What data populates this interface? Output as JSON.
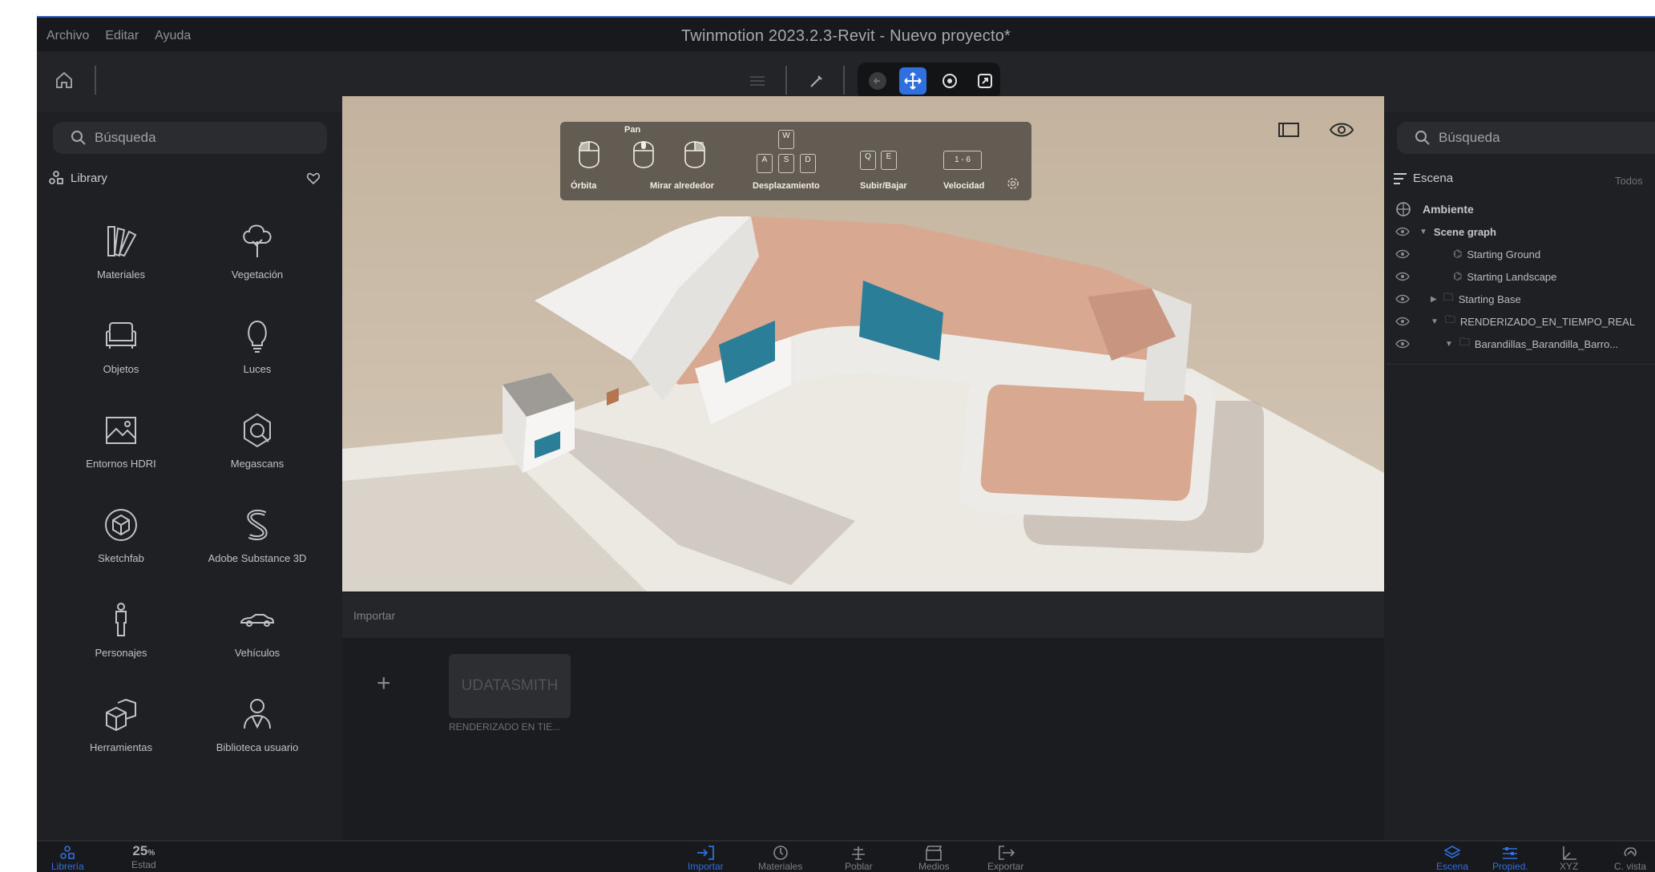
{
  "window": {
    "title": "Twinmotion 2023.2.3-Revit - Nuevo proyecto*"
  },
  "menu": [
    "Archivo",
    "Editar",
    "Ayuda"
  ],
  "left_search": {
    "placeholder": "Búsqueda"
  },
  "library": {
    "title": "Library",
    "items": [
      {
        "label": "Materiales",
        "icon": "materials-icon"
      },
      {
        "label": "Vegetación",
        "icon": "tree-icon"
      },
      {
        "label": "Objetos",
        "icon": "sofa-icon"
      },
      {
        "label": "Luces",
        "icon": "bulb-icon"
      },
      {
        "label": "Entornos HDRI",
        "icon": "hdri-image-icon"
      },
      {
        "label": "Megascans",
        "icon": "megascans-icon"
      },
      {
        "label": "Sketchfab",
        "icon": "cube-icon"
      },
      {
        "label": "Adobe Substance 3D",
        "icon": "substance-icon"
      },
      {
        "label": "Personajes",
        "icon": "person-icon"
      },
      {
        "label": "Vehículos",
        "icon": "car-icon"
      },
      {
        "label": "Herramientas",
        "icon": "boxes-icon"
      },
      {
        "label": "Biblioteca usuario",
        "icon": "user-library-icon"
      }
    ]
  },
  "nav_help": {
    "pan": "Pan",
    "orbit": "Órbita",
    "look": "Mirar alrededor",
    "move": "Desplazamiento",
    "updown": "Subir/Bajar",
    "speed": "Velocidad",
    "speed_value": "1 - 6",
    "keys": {
      "w": "W",
      "a": "A",
      "s": "S",
      "d": "D",
      "q": "Q",
      "e": "E"
    }
  },
  "import": {
    "title": "Importar",
    "thumb_label": "UDATASMITH",
    "thumb_caption": "RENDERIZADO EN TIE...",
    "add": "+"
  },
  "right_search": {
    "placeholder": "Búsqueda"
  },
  "scene": {
    "title": "Escena",
    "filter": "Todos",
    "ambient": "Ambiente",
    "graph": "Scene graph",
    "nodes": [
      "Starting Ground",
      "Starting Landscape",
      "Starting Base",
      "RENDERIZADO_EN_TIEMPO_REAL",
      "Barandillas_Barandilla_Barro..."
    ]
  },
  "bottom_left": [
    {
      "label": "Librería",
      "active": true
    },
    {
      "label": "Estad",
      "value": "25",
      "unit": "%"
    }
  ],
  "bottom_center": [
    {
      "label": "Importar",
      "active": true
    },
    {
      "label": "Materiales"
    },
    {
      "label": "Poblar"
    },
    {
      "label": "Medios"
    },
    {
      "label": "Exportar"
    }
  ],
  "bottom_right": [
    {
      "label": "Escena",
      "active": true
    },
    {
      "label": "Propied.",
      "active": true
    },
    {
      "label": "XYZ"
    },
    {
      "label": "C. vista"
    }
  ],
  "colors": {
    "accent": "#2f6fe0",
    "bg": "#1f2023"
  }
}
